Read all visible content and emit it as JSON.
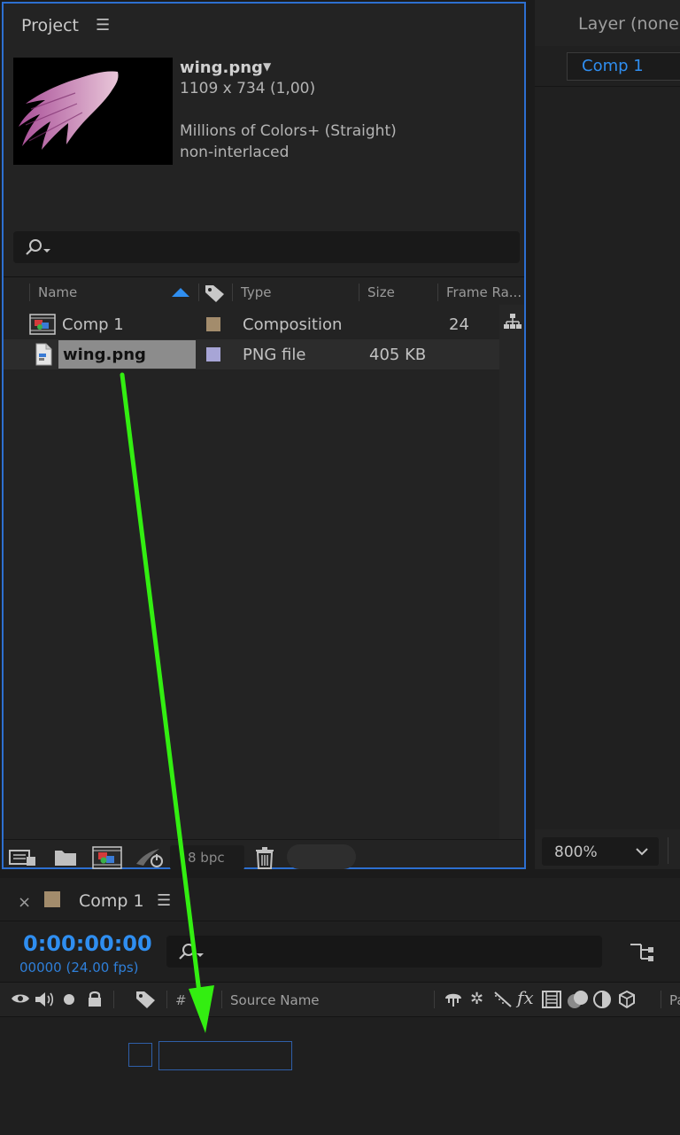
{
  "project_panel": {
    "title": "Project",
    "file_info": {
      "name": "wing.png",
      "dimensions": "1109 x 734 (1,00)",
      "color": "Millions of Colors+ (Straight)",
      "interlace": "non-interlaced"
    },
    "columns": {
      "name": "Name",
      "type": "Type",
      "size": "Size",
      "frame_rate": "Frame Ra..."
    },
    "rows": [
      {
        "name": "Comp 1",
        "type": "Composition",
        "size": "",
        "frame_rate": "24",
        "label_color": "#a38c6c"
      },
      {
        "name": "wing.png",
        "type": "PNG file",
        "size": "405 KB",
        "frame_rate": "",
        "label_color": "#a7a5d6"
      }
    ],
    "bpc": "8 bpc"
  },
  "layer_panel": {
    "title": "Layer (none)",
    "comp_tab": "Comp 1",
    "zoom": "800%"
  },
  "timeline": {
    "tab": "Comp 1",
    "timecode": "0:00:00:00",
    "fps": "00000 (24.00 fps)",
    "columns": {
      "hash": "#",
      "source_name": "Source Name",
      "parent": "Pa"
    }
  },
  "colors": {
    "accent": "#2d6fd0",
    "timecode": "#2f8ef0",
    "arrow": "#33ee11",
    "comp_label": "#a38c6c"
  }
}
